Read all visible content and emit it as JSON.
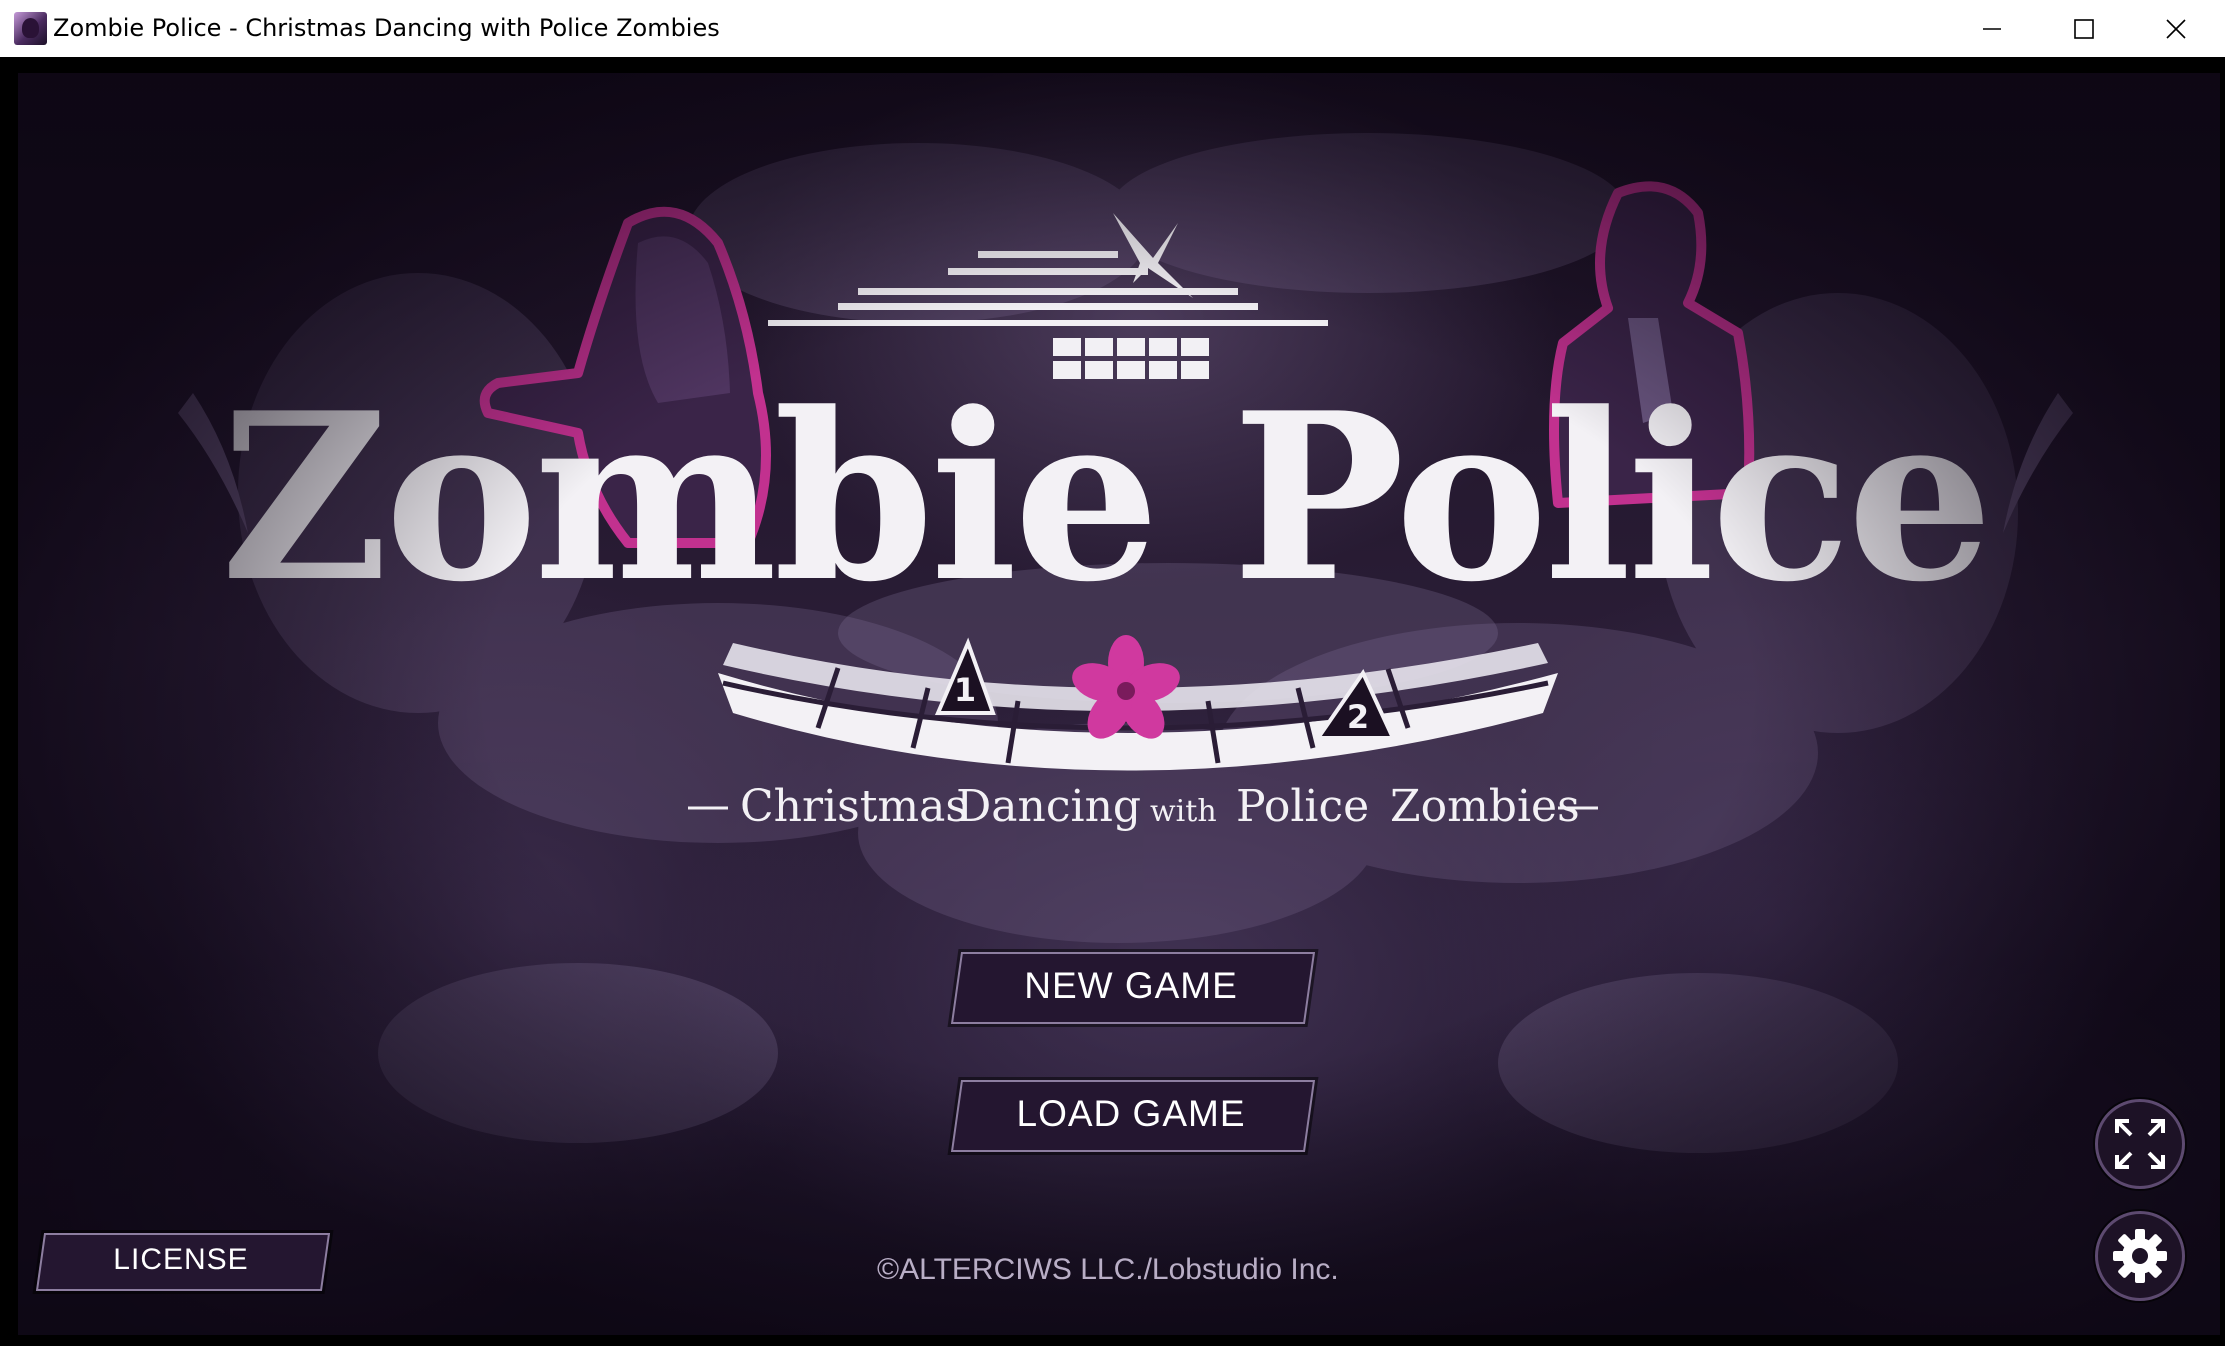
{
  "window": {
    "title": "Zombie Police - Christmas Dancing with Police Zombies",
    "controls": [
      "minimize-icon",
      "maximize-icon",
      "close-icon"
    ]
  },
  "logo": {
    "title": "Zombie Police",
    "subtitle_parts": [
      "Christmas",
      "Dancing",
      "with",
      "Police",
      "Zombies"
    ],
    "markers": [
      "1",
      "2"
    ]
  },
  "menu": {
    "new_game": "NEW GAME",
    "load_game": "LOAD GAME",
    "license": "LICENSE"
  },
  "footer": {
    "copyright": "©ALTERCIWS LLC./Lobstudio Inc."
  },
  "icons": {
    "fullscreen": "fullscreen-icon",
    "settings": "gear-icon"
  },
  "colors": {
    "accent_magenta": "#d0399f",
    "button_bg": "#241630",
    "text_light": "#ffffff"
  }
}
